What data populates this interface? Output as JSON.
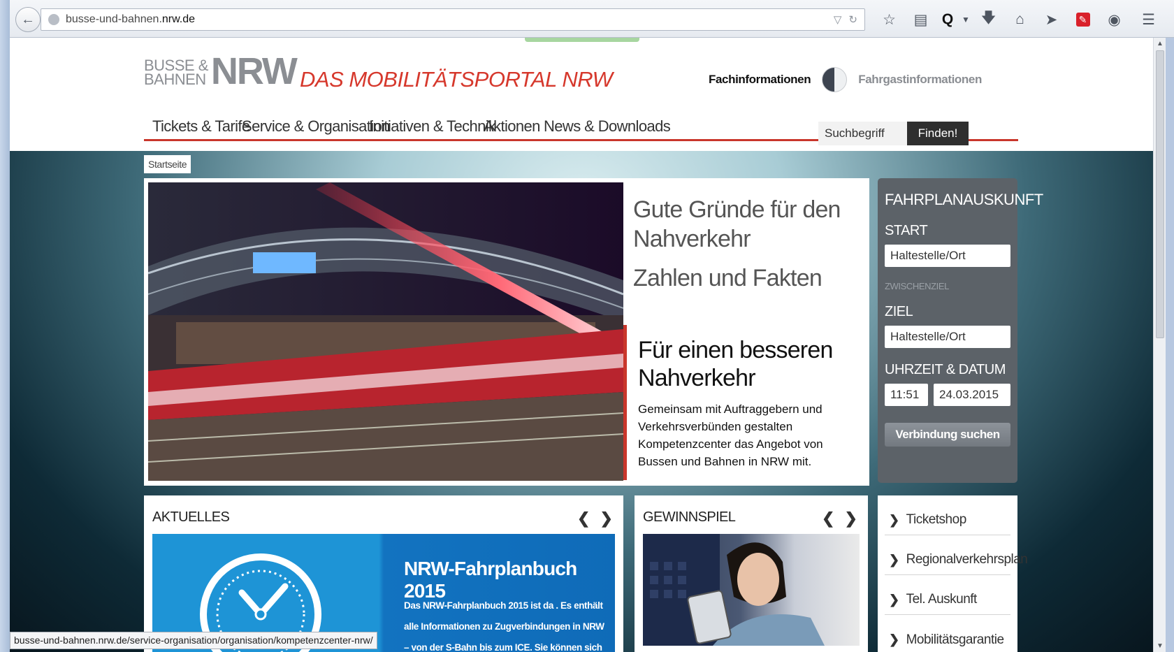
{
  "browser": {
    "url_prefix": "busse-und-bahnen.",
    "url_domain": "nrw.de",
    "toolbar_icons": [
      "star-icon",
      "reading-list-icon",
      "q-addon-icon",
      "dropdown-arrow-icon",
      "download-icon",
      "home-icon",
      "send-icon",
      "pdf-addon-icon",
      "chat-icon",
      "menu-icon"
    ]
  },
  "header": {
    "logo_line1": "BUSSE &",
    "logo_line2": "BAHNEN",
    "logo_nrw": "NRW",
    "portal_title": "DAS MOBILITÄTSPORTAL NRW",
    "audience_left": "Fachinformationen",
    "audience_right": "Fahrgastinformationen"
  },
  "nav": {
    "items": [
      "Tickets & Tarife",
      "Service & Organisation",
      "Initiativen & Technik",
      "Aktionen",
      "News & Downloads"
    ],
    "search_placeholder": "Suchbegriff",
    "search_button": "Finden!"
  },
  "breadcrumb": "Startseite",
  "teaser": {
    "link1": "Gute Gründe für den Nahverkehr",
    "link2": "Zahlen und Fakten",
    "active_title": "Für einen besseren Nahverkehr",
    "active_text": "Gemeinsam mit Auftraggebern und Verkehrsverbünden gestalten Kompetenzcenter das Angebot von Bussen und Bahnen in NRW mit."
  },
  "fahrplan": {
    "title": "FAHRPLANAUSKUNFT",
    "start_label": "START",
    "start_placeholder": "Haltestelle/Ort",
    "via_label": "ZWISCHENZIEL",
    "ziel_label": "ZIEL",
    "ziel_placeholder": "Haltestelle/Ort",
    "datetime_label": "UHRZEIT & DATUM",
    "time": "11:51",
    "date": "24.03.2015",
    "button": "Verbindung suchen"
  },
  "aktuelles": {
    "heading": "AKTUELLES",
    "card_title": "NRW-Fahrplanbuch 2015",
    "card_text": "Das NRW-Fahrplanbuch 2015 ist da . Es enthält alle Informationen zu Zugverbindungen in NRW – von der S-Bahn bis zum ICE. Sie können sich"
  },
  "gewinnspiel": {
    "heading": "GEWINNSPIEL"
  },
  "quicklinks": [
    "Ticketshop",
    "Regionalverkehrsplan",
    "Tel. Auskunft",
    "Mobilitätsgarantie"
  ],
  "status_url": "busse-und-bahnen.nrw.de/service-organisation/organisation/kompetenzcenter-nrw/",
  "colors": {
    "accent_red": "#c9362b",
    "panel_gray": "#5c6268",
    "aktuelles_blue": "#1e94d6"
  }
}
